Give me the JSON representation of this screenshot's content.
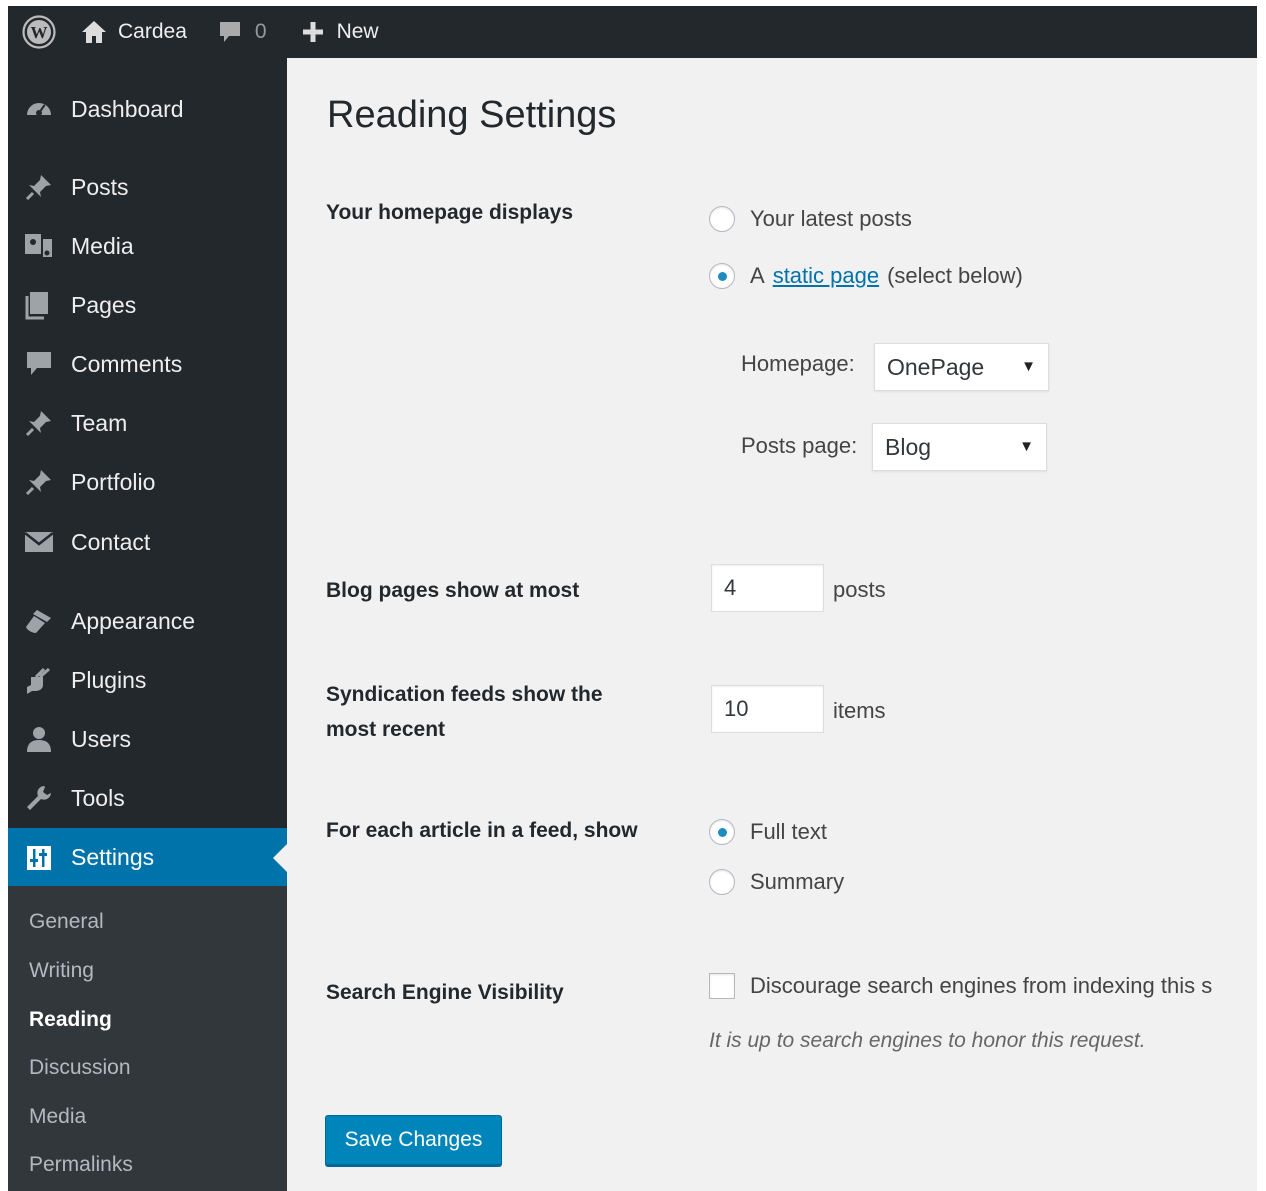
{
  "adminbar": {
    "site_name": "Cardea",
    "comments_count": "0",
    "new_label": "New"
  },
  "sidebar": {
    "items": [
      {
        "label": "Dashboard",
        "icon": "dashboard-icon"
      },
      {
        "label": "Posts",
        "icon": "pin-icon"
      },
      {
        "label": "Media",
        "icon": "media-icon"
      },
      {
        "label": "Pages",
        "icon": "pages-icon"
      },
      {
        "label": "Comments",
        "icon": "comment-icon"
      },
      {
        "label": "Team",
        "icon": "pin-icon"
      },
      {
        "label": "Portfolio",
        "icon": "pin-icon"
      },
      {
        "label": "Contact",
        "icon": "mail-icon"
      },
      {
        "label": "Appearance",
        "icon": "brush-icon"
      },
      {
        "label": "Plugins",
        "icon": "plugin-icon"
      },
      {
        "label": "Users",
        "icon": "user-icon"
      },
      {
        "label": "Tools",
        "icon": "wrench-icon"
      },
      {
        "label": "Settings",
        "icon": "settings-icon"
      }
    ],
    "submenu": [
      "General",
      "Writing",
      "Reading",
      "Discussion",
      "Media",
      "Permalinks"
    ],
    "active_submenu": "Reading"
  },
  "page": {
    "title": "Reading Settings",
    "homepage_displays": {
      "label": "Your homepage displays",
      "option_latest": "Your latest posts",
      "option_static_prefix": "A",
      "option_static_link": "static page",
      "option_static_suffix": "(select below)",
      "selected": "static",
      "homepage_label": "Homepage:",
      "homepage_value": "OnePage",
      "posts_page_label": "Posts page:",
      "posts_page_value": "Blog"
    },
    "blog_pages": {
      "label": "Blog pages show at most",
      "value": "4",
      "unit": "posts"
    },
    "syndication": {
      "label_line1": "Syndication feeds show the",
      "label_line2": "most recent",
      "value": "10",
      "unit": "items"
    },
    "feed_article": {
      "label": "For each article in a feed, show",
      "option_full": "Full text",
      "option_summary": "Summary",
      "selected": "full"
    },
    "search_visibility": {
      "label": "Search Engine Visibility",
      "checkbox_label": "Discourage search engines from indexing this s",
      "checked": false,
      "description": "It is up to search engines to honor this request."
    },
    "save_label": "Save Changes"
  },
  "colors": {
    "adminbar_bg": "#23282d",
    "sidebar_bg": "#23282d",
    "submenu_bg": "#32373c",
    "accent": "#0073aa",
    "button": "#0085ba",
    "content_bg": "#f1f1f1"
  }
}
